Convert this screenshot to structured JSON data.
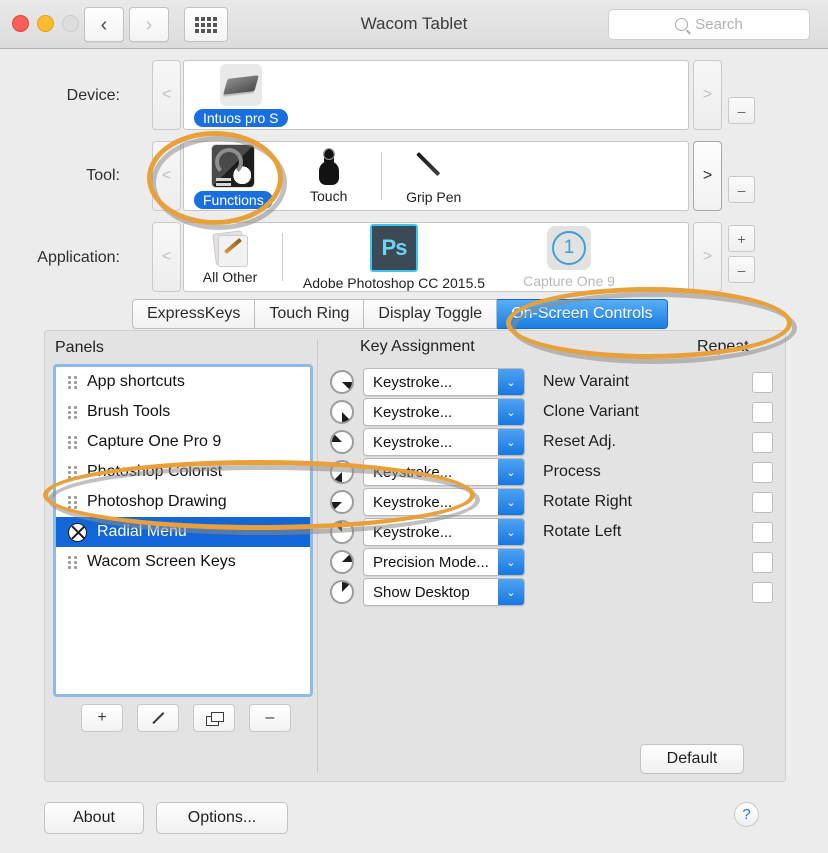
{
  "window": {
    "title": "Wacom Tablet",
    "search_placeholder": "Search",
    "back_glyph": "‹",
    "forward_glyph": "›"
  },
  "selectors": {
    "device": {
      "label": "Device:",
      "prev_glyph": "<",
      "next_glyph": ">",
      "remove_glyph": "–",
      "items": [
        {
          "label": "Intuos pro S",
          "icon": "tablet-icon",
          "selected": true
        }
      ]
    },
    "tool": {
      "label": "Tool:",
      "prev_glyph": "<",
      "next_glyph": ">",
      "remove_glyph": "–",
      "items": [
        {
          "label": "Functions",
          "icon": "functions-icon",
          "selected": true
        },
        {
          "label": "Touch",
          "icon": "touch-icon",
          "selected": false
        },
        {
          "label": "Grip Pen",
          "icon": "grip-pen-icon",
          "selected": false
        }
      ]
    },
    "application": {
      "label": "Application:",
      "prev_glyph": "<",
      "next_glyph": ">",
      "add_glyph": "+",
      "remove_glyph": "–",
      "items": [
        {
          "label": "All Other",
          "icon": "all-other-icon",
          "selected": false
        },
        {
          "label": "Adobe Photoshop CC 2015.5",
          "icon": "photoshop-icon",
          "selected": false
        },
        {
          "label": "Capture One 9",
          "icon": "capture-one-icon",
          "selected": false
        }
      ]
    }
  },
  "tabs": [
    {
      "label": "ExpressKeys",
      "active": false
    },
    {
      "label": "Touch Ring",
      "active": false
    },
    {
      "label": "Display Toggle",
      "active": false
    },
    {
      "label": "On-Screen Controls",
      "active": true
    }
  ],
  "panels": {
    "heading": "Panels",
    "items": [
      {
        "label": "App shortcuts",
        "icon": "drag-handle-icon",
        "selected": false
      },
      {
        "label": "Brush Tools",
        "icon": "drag-handle-icon",
        "selected": false
      },
      {
        "label": "Capture One Pro 9",
        "icon": "drag-handle-icon",
        "selected": false
      },
      {
        "label": "Photoshop Colorist",
        "icon": "drag-handle-icon",
        "selected": false
      },
      {
        "label": "Photoshop Drawing",
        "icon": "drag-handle-icon",
        "selected": false
      },
      {
        "label": "Radial Menu",
        "icon": "radial-menu-icon",
        "selected": true
      },
      {
        "label": "Wacom Screen Keys",
        "icon": "drag-handle-icon",
        "selected": false
      }
    ],
    "tools": [
      {
        "name": "add-panel-button",
        "glyph": "+"
      },
      {
        "name": "edit-panel-button",
        "glyph": "pencil"
      },
      {
        "name": "duplicate-panel-button",
        "glyph": "copy"
      },
      {
        "name": "remove-panel-button",
        "glyph": "–"
      }
    ]
  },
  "assignments": {
    "key_assignment_header": "Key Assignment",
    "repeat_header": "Repeat",
    "popup_arrow_glyph": "⌄",
    "rows": [
      {
        "sector": 0,
        "value": "Keystroke...",
        "action": "New Varaint",
        "repeat": false
      },
      {
        "sector": 1,
        "value": "Keystroke...",
        "action": "Clone Variant",
        "repeat": false
      },
      {
        "sector": 2,
        "value": "Keystroke...",
        "action": "Reset Adj.",
        "repeat": false
      },
      {
        "sector": 3,
        "value": "Keystroke...",
        "action": "Process",
        "repeat": false
      },
      {
        "sector": 4,
        "value": "Keystroke...",
        "action": "Rotate Right",
        "repeat": false
      },
      {
        "sector": 5,
        "value": "Keystroke...",
        "action": "Rotate Left",
        "repeat": false
      },
      {
        "sector": 6,
        "value": "Precision Mode...",
        "action": "",
        "repeat": false
      },
      {
        "sector": 7,
        "value": "Show Desktop",
        "action": "",
        "repeat": false
      }
    ],
    "default_button": "Default"
  },
  "footer": {
    "about_label": "About",
    "options_label": "Options...",
    "help_glyph": "?"
  },
  "annotations": {
    "color": "#e8a13a",
    "shadow_color": "#8d8d8d",
    "targets": [
      "tool-functions",
      "tab-on-screen-controls",
      "panel-radial-menu"
    ]
  },
  "colors": {
    "accent_blue": "#1b7ee4",
    "selection_blue": "#1266d8",
    "annotation_orange": "#e8a13a",
    "window_bg": "#ececec",
    "panel_bg": "#e3e3e3"
  }
}
